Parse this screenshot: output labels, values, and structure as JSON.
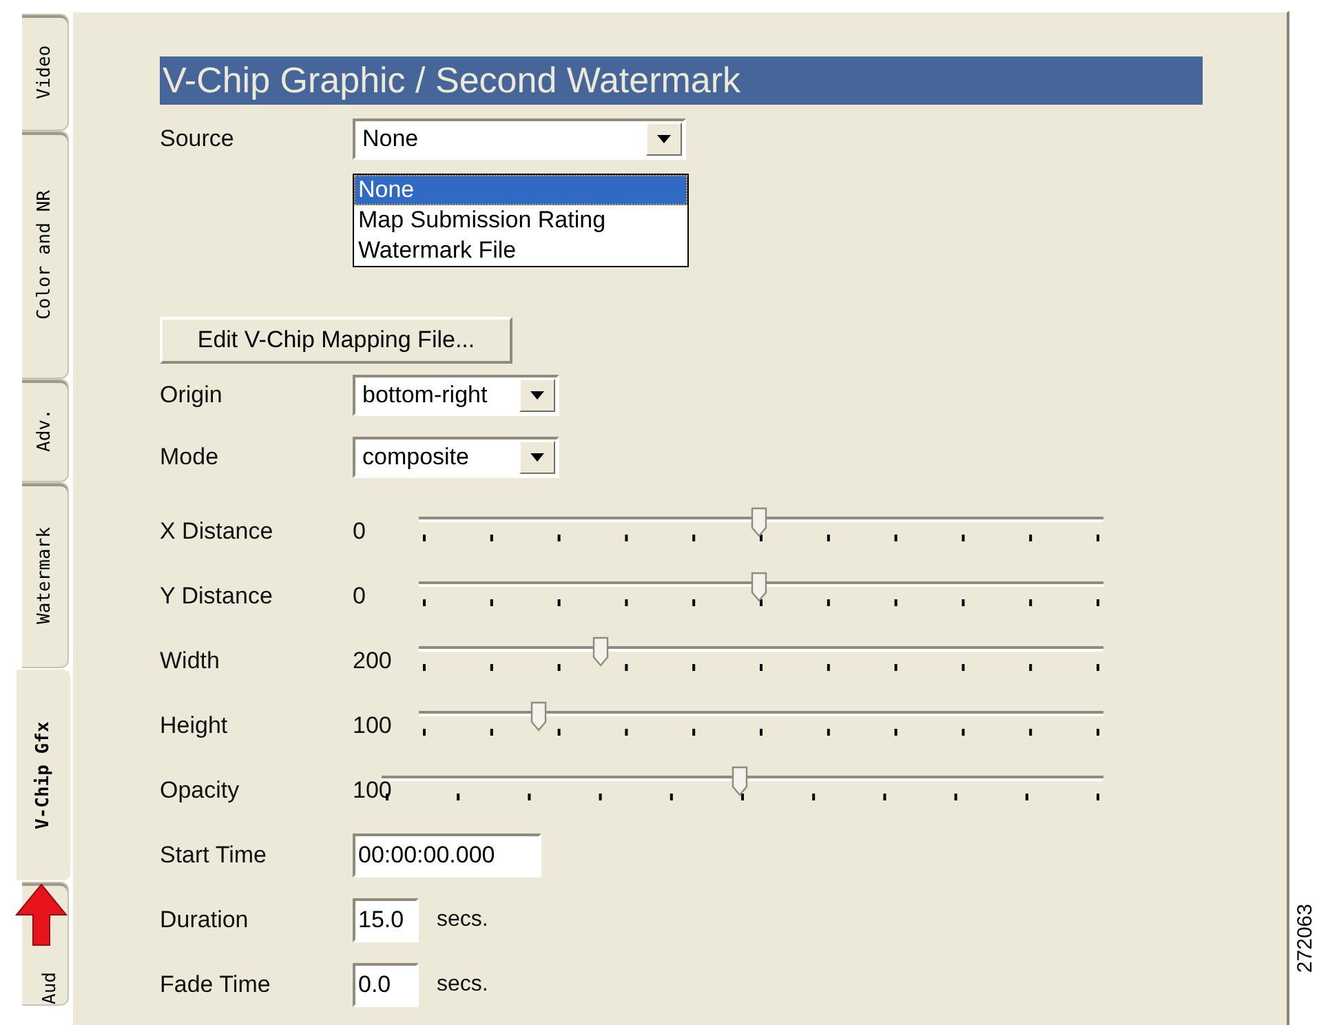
{
  "tabs": [
    {
      "label": "Video",
      "selected": false
    },
    {
      "label": "Color and NR",
      "selected": false
    },
    {
      "label": "Adv.",
      "selected": false
    },
    {
      "label": "Watermark",
      "selected": false
    },
    {
      "label": "V-Chip Gfx",
      "selected": true
    },
    {
      "label": "Aud",
      "selected": false
    }
  ],
  "section_title": "V-Chip Graphic / Second Watermark",
  "source": {
    "label": "Source",
    "value": "None",
    "options": [
      {
        "label": "None",
        "selected": true
      },
      {
        "label": "Map Submission Rating",
        "selected": false
      },
      {
        "label": "Watermark File",
        "selected": false
      }
    ]
  },
  "edit_button": "Edit V-Chip Mapping File...",
  "origin": {
    "label": "Origin",
    "value": "bottom-right"
  },
  "mode": {
    "label": "Mode",
    "value": "composite"
  },
  "sliders": [
    {
      "label": "X Distance",
      "reading": "0",
      "level": 0.5
    },
    {
      "label": "Y Distance",
      "reading": "0",
      "level": 0.5
    },
    {
      "label": "Width",
      "reading": "200",
      "level": 0.27
    },
    {
      "label": "Height",
      "reading": "100",
      "level": 0.18
    },
    {
      "label": "Opacity",
      "reading": "100",
      "level": 0.5
    }
  ],
  "times": [
    {
      "label": "Start Time",
      "value": "00:00:00.000"
    },
    {
      "label": "Duration",
      "value": "15.0",
      "unit": "secs."
    },
    {
      "label": "Fade Time",
      "value": "0.0",
      "unit": "secs."
    }
  ],
  "figure_id": "272063"
}
